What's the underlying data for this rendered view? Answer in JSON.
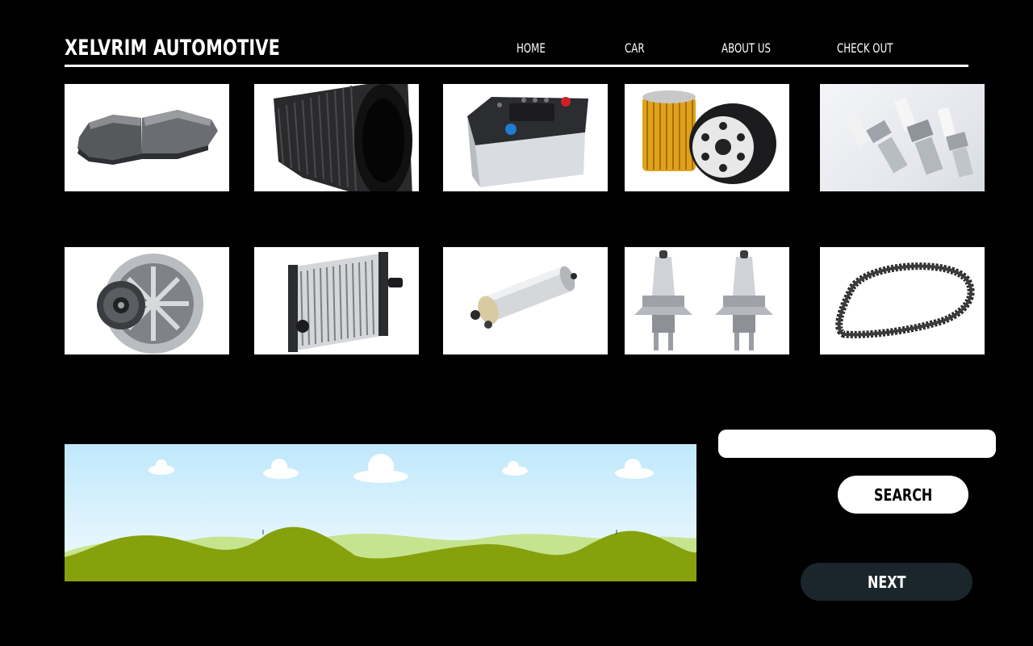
{
  "header": {
    "brand": "XELVRIM AUTOMOTIVE",
    "nav": [
      "HOME",
      "CAR",
      "ABOUT US",
      "CHECK OUT"
    ]
  },
  "products": [
    {
      "icon": "brake-pads-icon"
    },
    {
      "icon": "air-filter-icon"
    },
    {
      "icon": "car-battery-icon"
    },
    {
      "icon": "oil-filters-icon"
    },
    {
      "icon": "spark-plugs-icon"
    },
    {
      "icon": "alternator-icon"
    },
    {
      "icon": "radiator-icon"
    },
    {
      "icon": "fuel-pump-icon"
    },
    {
      "icon": "headlight-bulbs-icon"
    },
    {
      "icon": "timing-belt-icon"
    }
  ],
  "banner": {
    "icon": "landscape-banner-image"
  },
  "search": {
    "value": "",
    "button_label": "SEARCH"
  },
  "next": {
    "label": "NEXT"
  },
  "colors": {
    "background": "#000000",
    "text": "#ffffff",
    "next_button": "#1b262c",
    "hills": "#86a10c",
    "sky": "#bfe8fb"
  }
}
